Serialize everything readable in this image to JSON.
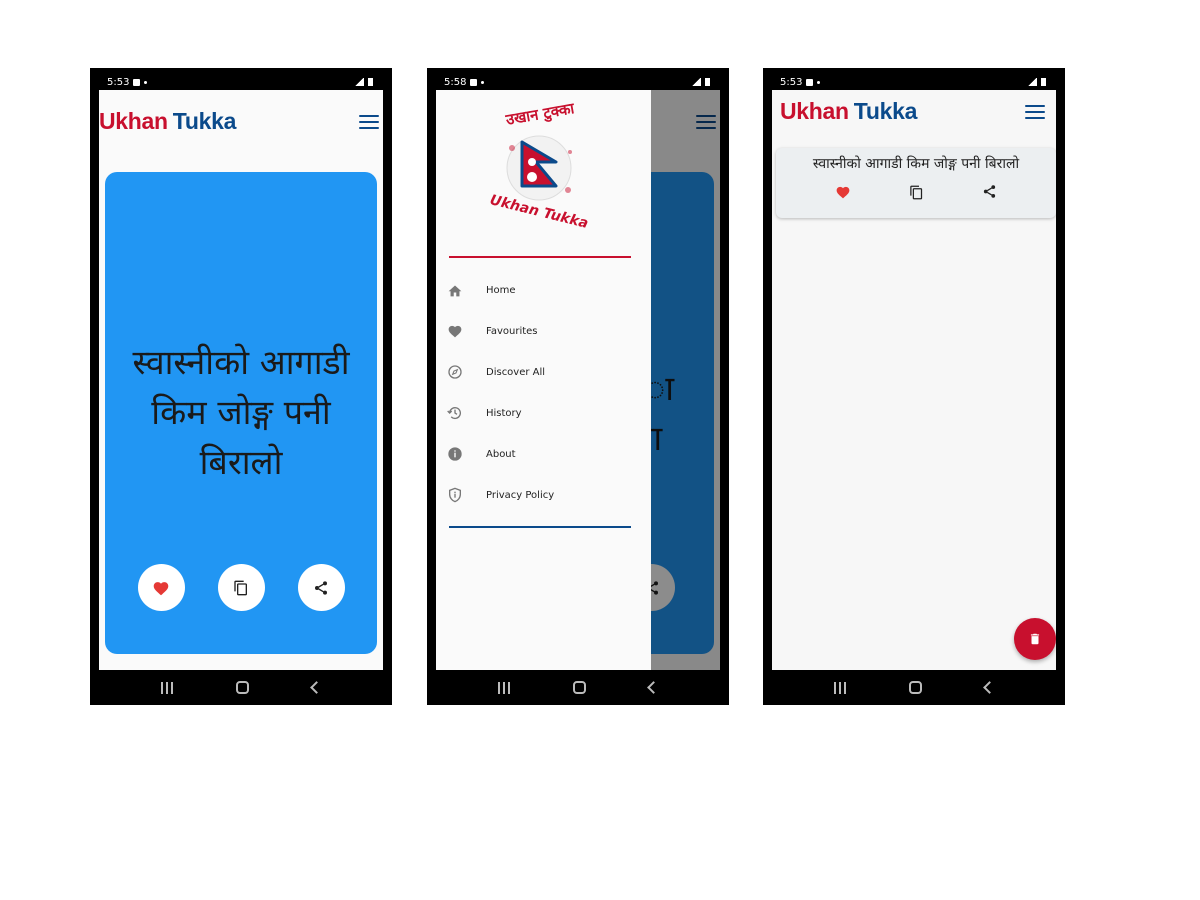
{
  "app": {
    "brand_first": "Ukhan",
    "brand_second": "Tukka",
    "brand_red": "#c8102e",
    "brand_blue": "#0b4a8b",
    "card_color": "#2196f3"
  },
  "phone1": {
    "time": "5:53",
    "proverb": "स्वास्नीको आगाडी किम जोङ्ग पनी बिरालो",
    "actions": [
      "heart-icon",
      "copy-icon",
      "share-icon"
    ]
  },
  "phone2": {
    "time": "5:58",
    "logo_text_nepali": "उखान टुक्का",
    "logo_text_latin": "Ukhan Tukka",
    "drawer_items": [
      {
        "label": "Home",
        "icon": "home-icon"
      },
      {
        "label": "Favourites",
        "icon": "heart-icon"
      },
      {
        "label": "Discover All",
        "icon": "compass-icon"
      },
      {
        "label": "History",
        "icon": "history-icon"
      },
      {
        "label": "About",
        "icon": "info-icon"
      },
      {
        "label": "Privacy Policy",
        "icon": "shield-icon"
      }
    ],
    "ghost_text_line1": "ा",
    "ghost_text_line2": "मा"
  },
  "phone3": {
    "time": "5:53",
    "favourite_item": "स्वास्नीको आगाडी किम जोङ्ग पनी बिरालो",
    "fab_icon": "trash-icon"
  }
}
